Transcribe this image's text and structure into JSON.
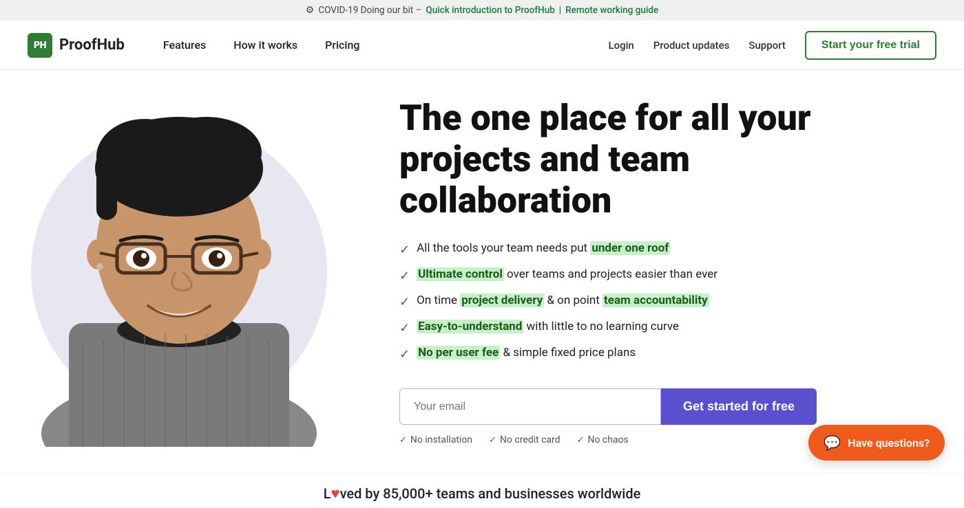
{
  "banner": {
    "gear": "⚙",
    "text_before": "COVID-19 Doing our bit –",
    "link1_text": "Quick introduction to ProofHub",
    "separator": "|",
    "link2_text": "Remote working guide"
  },
  "navbar": {
    "logo_initials": "PH",
    "logo_name": "ProofHub",
    "nav_links": [
      {
        "label": "Features",
        "key": "features"
      },
      {
        "label": "How it works",
        "key": "how-it-works"
      },
      {
        "label": "Pricing",
        "key": "pricing"
      }
    ],
    "right_links": [
      {
        "label": "Login",
        "key": "login"
      },
      {
        "label": "Product updates",
        "key": "product-updates"
      },
      {
        "label": "Support",
        "key": "support"
      }
    ],
    "cta_label": "Start your free trial"
  },
  "hero": {
    "headline": "The one place for all your projects and team collaboration",
    "checklist": [
      {
        "text_before": "All the tools your team needs put ",
        "highlight": "under one roof",
        "text_after": ""
      },
      {
        "text_before": "",
        "highlight": "Ultimate control",
        "text_after": " over teams and projects easier than ever"
      },
      {
        "text_before": "On time ",
        "highlight": "project delivery",
        "text_mid": " & on point ",
        "highlight2": "team accountability",
        "text_after": ""
      },
      {
        "text_before": "",
        "highlight": "Easy-to-understand",
        "text_after": " with little to no learning curve"
      },
      {
        "text_before": "",
        "highlight": "No per user fee",
        "text_after": " & simple fixed price plans"
      }
    ],
    "email_placeholder": "Your email",
    "cta_button": "Get started for free",
    "no_items": [
      "No installation",
      "No credit card",
      "No chaos"
    ]
  },
  "loved_bar": {
    "text_before": "L",
    "heart": "♥",
    "text_after": "ved by 85,000+ teams and businesses worldwide"
  },
  "chat": {
    "icon": "💬",
    "label": "Have questions?"
  }
}
